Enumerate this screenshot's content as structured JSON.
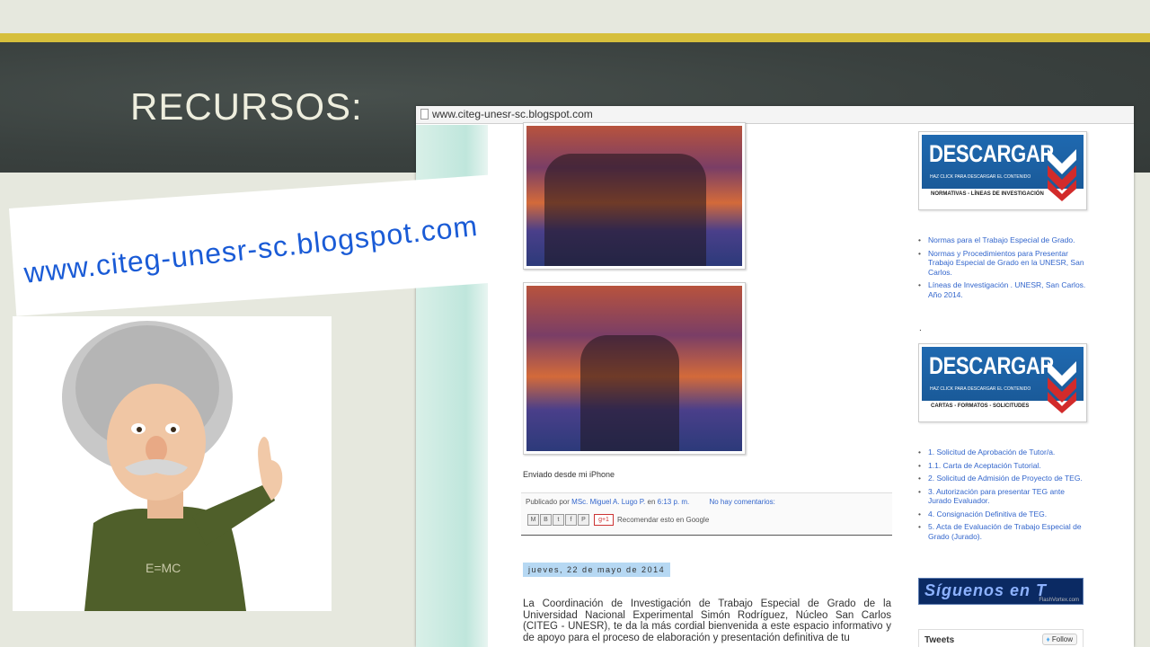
{
  "slide": {
    "title": "RECURSOS:",
    "url_callout": "www.citeg-unesr-sc.blogspot.com"
  },
  "colors": {
    "gold_bar": "#d6bf3c",
    "chalkboard": "#3a413f",
    "url_callout": "#1a5bd6",
    "link_blue": "#3366cc",
    "banner_blue": "#1f69b0",
    "date_highlight": "#b6d8f3"
  },
  "mascot": {
    "shirt_text": "E=MC"
  },
  "screenshot": {
    "address": "www.citeg-unesr-sc.blogspot.com",
    "post": {
      "enviado": "Enviado desde mi iPhone",
      "publicado_por": "Publicado por",
      "author": "MSc. Miguel A. Lugo P.",
      "en": "en",
      "time": "6:13 p. m.",
      "comments": "No hay comentarios:",
      "share_icons": [
        "M",
        "B",
        "t",
        "f",
        "P"
      ],
      "gplus": "g+1",
      "recomendar": "Recomendar esto en Google"
    },
    "date_header": "jueves, 22 de mayo de 2014",
    "body_text": "La Coordinación de Investigación de Trabajo Especial de Grado de la Universidad Nacional Experimental Simón Rodríguez, Núcleo San Carlos (CITEG - UNESR), te da la más cordial  bienvenida a este espacio informativo y de apoyo para el proceso de elaboración y presentación  definitiva de tu",
    "sidebar": {
      "banner1": {
        "title": "DESCARGAR",
        "sub": "HAZ CLICK PARA DESCARGAR EL CONTENIDO",
        "caption": "NORMATIVAS - LÍNEAS DE INVESTIGACIÓN"
      },
      "list1": [
        "Normas para el Trabajo Especial de Grado.",
        "Normas y Procedimientos para Presentar Trabajo Especial de Grado en la UNESR, San Carlos.",
        "Líneas de Investigación . UNESR, San Carlos. Año 2014."
      ],
      "separator": ".",
      "banner2": {
        "title": "DESCARGAR",
        "sub": "HAZ CLICK PARA DESCARGAR EL CONTENIDO",
        "caption": "CARTAS - FORMATOS - SOLICITUDES"
      },
      "list2": [
        "1. Solicitud de Aprobación de Tutor/a.",
        "1.1. Carta de Aceptación Tutorial.",
        "2. Solicitud de Admisión de Proyecto de TEG.",
        "3. Autorización para presentar TEG ante Jurado Evaluador.",
        "4. Consignación Definitiva de TEG.",
        "5. Acta de Evaluación de Trabajo Especial de Grado (Jurado)."
      ],
      "siguenos": "Síguenos en T",
      "siguenos_sub": "FlashVortex.com",
      "tweets": "Tweets",
      "follow": "Follow"
    }
  }
}
